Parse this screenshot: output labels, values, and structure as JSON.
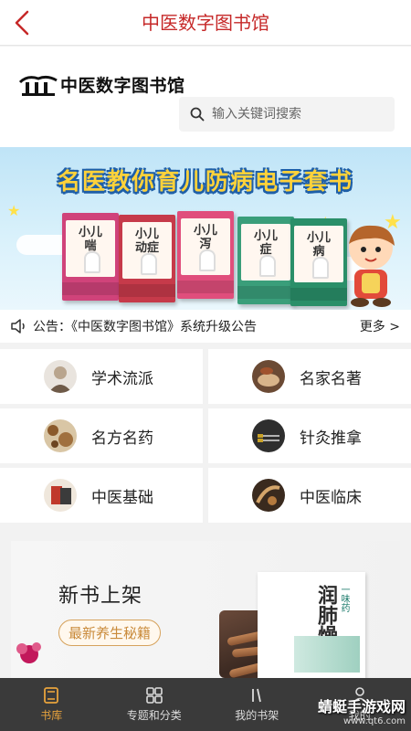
{
  "colors": {
    "brand": "#c62828",
    "accent": "#e8a33c",
    "tabbar_bg": "#3a3a3a"
  },
  "topbar": {
    "title": "中医数字图书馆",
    "back_icon": "chevron-left-icon"
  },
  "logo": {
    "text": "中医数字图书馆"
  },
  "search": {
    "placeholder": "输入关键词搜索",
    "value": ""
  },
  "banner": {
    "title": "名医教你育儿防病电子套书",
    "books": [
      {
        "title": "小儿\n喘",
        "color": "#d0437a"
      },
      {
        "title": "小儿\n动症",
        "color": "#c63a4a"
      },
      {
        "title": "小儿\n泻",
        "color": "#e04e7c"
      },
      {
        "title": "小儿\n症",
        "color": "#3a9e7a"
      },
      {
        "title": "小儿\n病",
        "color": "#2a8f69"
      }
    ]
  },
  "notice": {
    "icon": "speaker-icon",
    "text": "公告：《中医数字图书馆》系统升级公告",
    "more": "更多 >"
  },
  "categories": [
    {
      "label": "学术流派",
      "icon": "portrait-icon"
    },
    {
      "label": "名家名著",
      "icon": "herb-bowl-icon"
    },
    {
      "label": "名方名药",
      "icon": "herbs-icon"
    },
    {
      "label": "针灸推拿",
      "icon": "needles-icon"
    },
    {
      "label": "中医基础",
      "icon": "book-icon"
    },
    {
      "label": "中医临床",
      "icon": "dried-herb-icon"
    }
  ],
  "new_books": {
    "title": "新书上架",
    "badge": "最新养生秘籍",
    "cover_title": "润肺燥",
    "cover_sub": "一味药"
  },
  "tabbar": [
    {
      "label": "书库",
      "icon": "library-icon",
      "active": true
    },
    {
      "label": "专题和分类",
      "icon": "grid-icon",
      "active": false
    },
    {
      "label": "我的书架",
      "icon": "bookshelf-icon",
      "active": false
    },
    {
      "label": "我的",
      "icon": "user-icon",
      "active": false
    }
  ],
  "watermark": {
    "main": "蜻蜓手游戏网",
    "sub": "www.qt6.com"
  }
}
